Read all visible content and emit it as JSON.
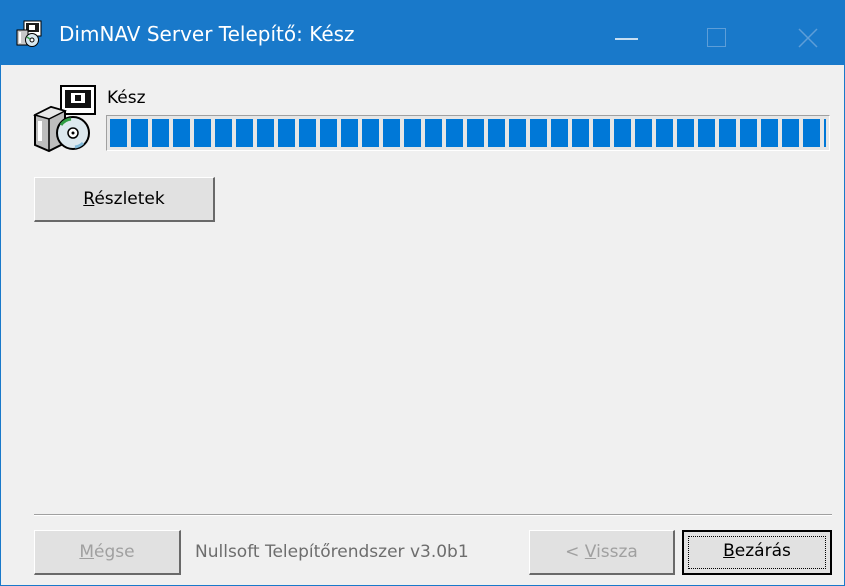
{
  "window": {
    "title": "DimNAV Server Telepítő: Kész",
    "icon": "installer-icon",
    "controls": {
      "minimize": "minimize-icon",
      "maximize": "maximize-icon",
      "close": "close-icon"
    }
  },
  "header": {
    "icon": "install-package-cd-icon",
    "status": "Kész"
  },
  "progress": {
    "value_percent": 100,
    "color": "#0078d7"
  },
  "details_button": {
    "accel": "R",
    "rest": "észletek"
  },
  "footer": {
    "cancel": {
      "accel": "M",
      "rest": "égse",
      "enabled": false
    },
    "branding": "Nullsoft Telepítőrendszer v3.0b1",
    "back": {
      "prefix": "< ",
      "accel": "V",
      "rest": "issza",
      "enabled": false
    },
    "close": {
      "accel": "B",
      "rest": "ezárás",
      "enabled": true
    }
  },
  "colors": {
    "titlebar": "#1979ca",
    "background": "#f0f0f0",
    "disabled_text": "#a0a0a0"
  }
}
